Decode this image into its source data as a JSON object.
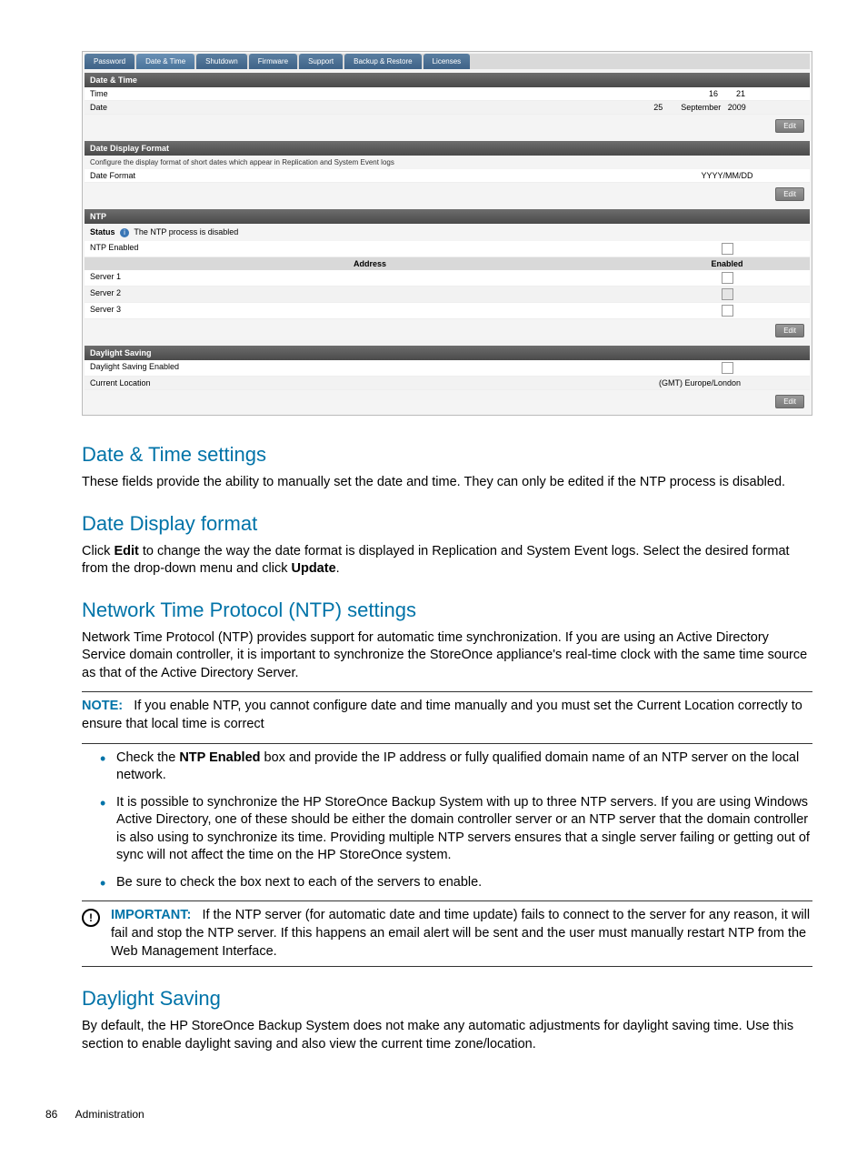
{
  "screenshot": {
    "tabs": [
      "Password",
      "Date & Time",
      "Shutdown",
      "Firmware",
      "Support",
      "Backup & Restore",
      "Licenses"
    ],
    "datetime": {
      "header": "Date & Time",
      "time_label": "Time",
      "time_h": "16",
      "time_m": "21",
      "date_label": "Date",
      "date_d": "25",
      "date_m": "September",
      "date_y": "2009",
      "edit": "Edit"
    },
    "dateformat": {
      "header": "Date Display Format",
      "desc": "Configure the display format of short dates which appear in Replication and System Event logs",
      "label": "Date Format",
      "value": "YYYY/MM/DD",
      "edit": "Edit"
    },
    "ntp": {
      "header": "NTP",
      "status_label": "Status",
      "status_text": "The NTP process is disabled",
      "enabled_label": "NTP Enabled",
      "col_addr": "Address",
      "col_en": "Enabled",
      "servers": [
        "Server 1",
        "Server 2",
        "Server 3"
      ],
      "edit": "Edit"
    },
    "daylight": {
      "header": "Daylight Saving",
      "enabled_label": "Daylight Saving Enabled",
      "loc_label": "Current Location",
      "loc_value": "(GMT) Europe/London",
      "edit": "Edit"
    }
  },
  "doc": {
    "h1": "Date & Time settings",
    "p1": "These fields provide the ability to manually set the date and time. They can only be edited if the NTP process is disabled.",
    "h2": "Date Display format",
    "p2a": "Click ",
    "p2b": "Edit",
    "p2c": " to change the way the date format is displayed in Replication and System Event logs. Select the desired format from the drop-down menu and click ",
    "p2d": "Update",
    "p2e": ".",
    "h3": "Network Time Protocol (NTP) settings",
    "p3": "Network Time Protocol (NTP) provides support for automatic time synchronization. If you are using an Active Directory Service domain controller, it is important to synchronize the StoreOnce appliance's real-time clock with the same time source as that of the Active Directory Server.",
    "note_label": "NOTE:",
    "note_text": "If you enable NTP, you cannot configure date and time manually and you must set the Current Location correctly to ensure that local time is correct",
    "li1a": "Check the ",
    "li1b": "NTP Enabled",
    "li1c": " box and provide the IP address or fully qualified domain name of an NTP server on the local network.",
    "li2": "It is possible to synchronize the HP StoreOnce Backup System with up to three NTP servers. If you are using Windows Active Directory, one of these should be either the domain controller server or an NTP server that the domain controller is also using to synchronize its time. Providing multiple NTP servers ensures that a single server failing or getting out of sync will not affect the time on the HP StoreOnce system.",
    "li3": "Be sure to check the box next to each of the servers to enable.",
    "imp_label": "IMPORTANT:",
    "imp_text": "If the NTP server (for automatic date and time update) fails to connect to the server for any reason, it will fail and stop the NTP server. If this happens an email alert will be sent and the user must manually restart NTP from the Web Management Interface.",
    "h4": "Daylight Saving",
    "p4": "By default, the HP StoreOnce Backup System does not make any automatic adjustments for daylight saving time. Use this section to enable daylight saving and also view the current time zone/location.",
    "page_num": "86",
    "footer": "Administration"
  }
}
